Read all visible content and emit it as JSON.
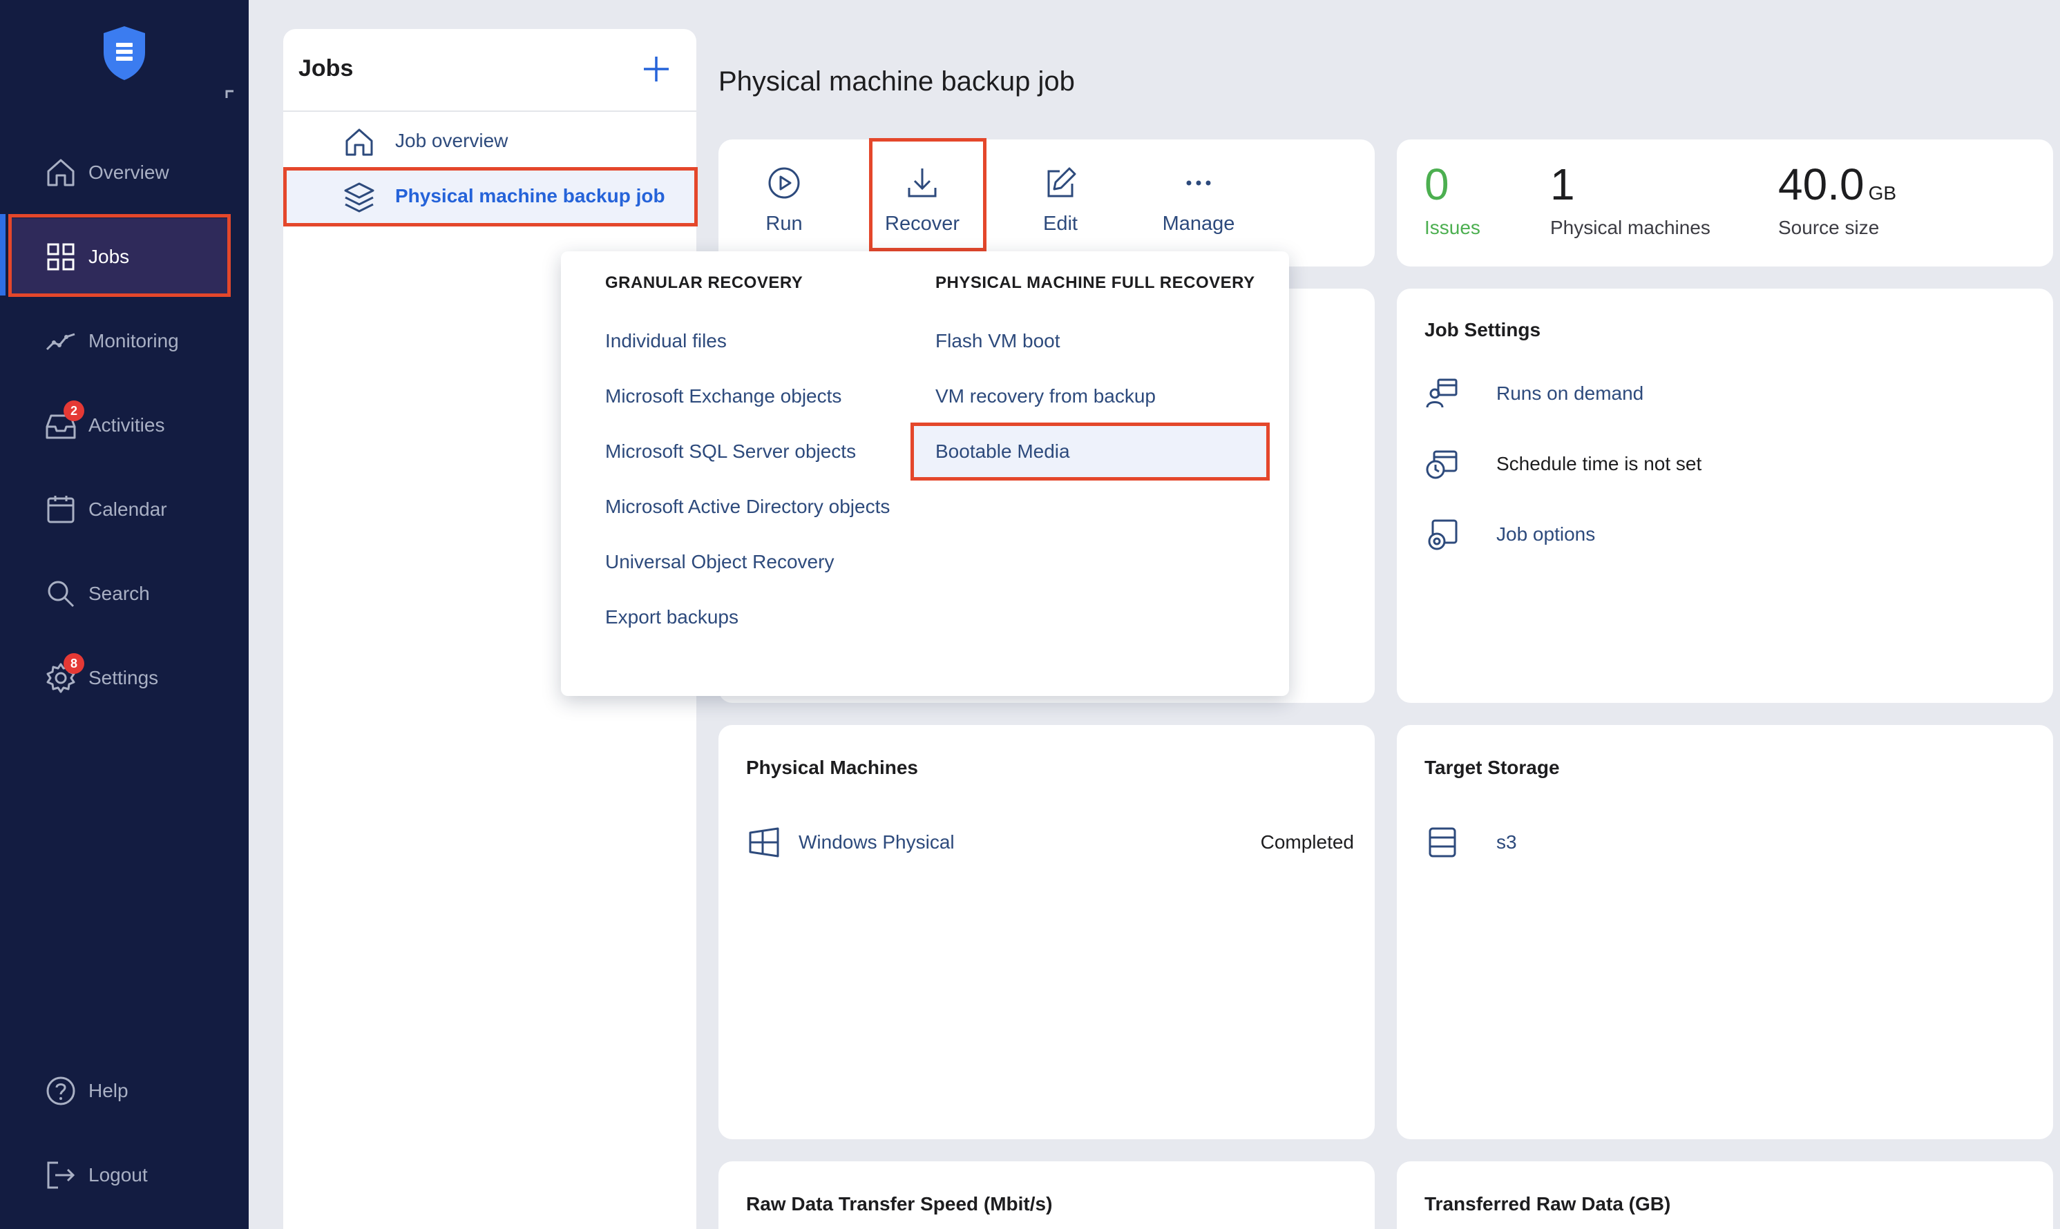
{
  "sidebar": {
    "logo_icon": "shield-logo-icon",
    "collapse_icon": "collapse-corner-icon",
    "items": [
      {
        "label": "Overview",
        "icon": "home-icon"
      },
      {
        "label": "Jobs",
        "icon": "grid-icon"
      },
      {
        "label": "Monitoring",
        "icon": "chart-line-icon"
      },
      {
        "label": "Activities",
        "icon": "inbox-icon",
        "badge": "2"
      },
      {
        "label": "Calendar",
        "icon": "calendar-icon"
      },
      {
        "label": "Search",
        "icon": "search-icon"
      },
      {
        "label": "Settings",
        "icon": "gear-icon",
        "badge": "8"
      }
    ],
    "bottom_items": [
      {
        "label": "Help",
        "icon": "help-icon"
      },
      {
        "label": "Logout",
        "icon": "logout-icon"
      }
    ]
  },
  "jobs_panel": {
    "title": "Jobs",
    "add_icon": "plus-icon",
    "rows": [
      {
        "label": "Job overview",
        "icon": "home-icon"
      },
      {
        "label": "Physical machine backup job",
        "icon": "stack-icon",
        "selected": true
      }
    ]
  },
  "main": {
    "page_title": "Physical machine backup job",
    "toolbar": {
      "run": "Run",
      "recover": "Recover",
      "edit": "Edit",
      "manage": "Manage"
    },
    "stats": {
      "issues_value": "0",
      "issues_label": "Issues",
      "machines_value": "1",
      "machines_label": "Physical machines",
      "size_value": "40.0",
      "size_unit": "GB",
      "size_label": "Source size"
    },
    "job_settings": {
      "title": "Job Settings",
      "runs": "Runs on demand",
      "schedule": "Schedule time is not set",
      "options": "Job options"
    },
    "physical_machines": {
      "title": "Physical Machines",
      "machine_name": "Windows Physical",
      "machine_status": "Completed"
    },
    "target_storage": {
      "title": "Target Storage",
      "storage_name": "s3"
    },
    "raw_speed_title": "Raw Data Transfer Speed (Mbit/s)",
    "raw_data_title": "Transferred Raw Data (GB)"
  },
  "dropdown": {
    "granular_heading": "GRANULAR RECOVERY",
    "granular_items": [
      "Individual files",
      "Microsoft Exchange objects",
      "Microsoft SQL Server objects",
      "Microsoft Active Directory objects",
      "Universal Object Recovery",
      "Export backups"
    ],
    "full_heading": "PHYSICAL MACHINE FULL RECOVERY",
    "full_items": [
      "Flash VM boot",
      "VM recovery from backup",
      "Bootable Media"
    ]
  },
  "colors": {
    "sidebar_bg": "#131c41",
    "accent": "#2563d9",
    "link": "#2d4a7c",
    "highlight": "#e4472b",
    "issues_ok": "#4caf50",
    "badge": "#e53935"
  }
}
